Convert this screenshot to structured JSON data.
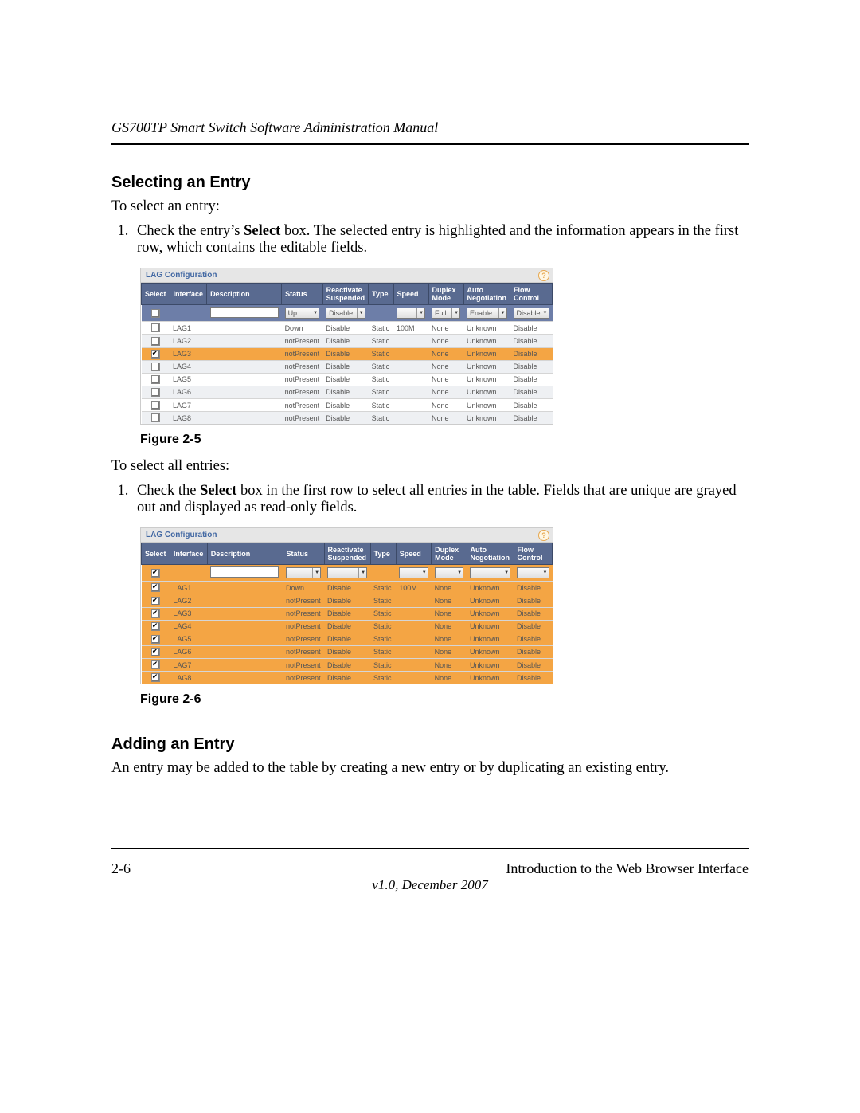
{
  "header": {
    "title": "GS700TP Smart Switch Software Administration Manual"
  },
  "section1": {
    "heading": "Selecting an Entry"
  },
  "para1": "To select an entry:",
  "step1_pre": "Check the entry’s ",
  "step1_bold": "Select",
  "step1_post": " box. The selected entry is highlighted and the information appears in the first row, which contains the editable fields.",
  "shot": {
    "title": "LAG Configuration",
    "help": "?",
    "cols": [
      "Select",
      "Interface",
      "Description",
      "Status",
      "Reactivate Suspended",
      "Type",
      "Speed",
      "Duplex Mode",
      "Auto Negotiation",
      "Flow Control"
    ],
    "editRow": {
      "status": "Up",
      "reactivate": "Disable",
      "speed": "",
      "duplex": "Full",
      "autoneg": "Enable",
      "flow": "Disable"
    }
  },
  "fig1cap": "Figure 2-5",
  "para2": "To select all entries:",
  "step2_pre": "Check the ",
  "step2_bold": "Select",
  "step2_post": " box in the first row to select all entries in the table. Fields that are unique are grayed out and displayed as read-only fields.",
  "fig2cap": "Figure 2-6",
  "section2": {
    "heading": "Adding an Entry"
  },
  "para3": "An entry may be added to the table by creating a new entry or by duplicating an existing entry.",
  "footer": {
    "page": "2-6",
    "chapter": "Introduction to the Web Browser Interface",
    "version": "v1.0, December 2007"
  },
  "rows1": [
    {
      "checked": false,
      "if": "LAG1",
      "status": "Down",
      "react": "Disable",
      "type": "Static",
      "speed": "100M",
      "dup": "None",
      "auto": "Unknown",
      "flow": "Disable",
      "cls": ""
    },
    {
      "checked": false,
      "if": "LAG2",
      "status": "notPresent",
      "react": "Disable",
      "type": "Static",
      "speed": "",
      "dup": "None",
      "auto": "Unknown",
      "flow": "Disable",
      "cls": "row-alt"
    },
    {
      "checked": true,
      "if": "LAG3",
      "status": "notPresent",
      "react": "Disable",
      "type": "Static",
      "speed": "",
      "dup": "None",
      "auto": "Unknown",
      "flow": "Disable",
      "cls": "row-selected"
    },
    {
      "checked": false,
      "if": "LAG4",
      "status": "notPresent",
      "react": "Disable",
      "type": "Static",
      "speed": "",
      "dup": "None",
      "auto": "Unknown",
      "flow": "Disable",
      "cls": "row-alt"
    },
    {
      "checked": false,
      "if": "LAG5",
      "status": "notPresent",
      "react": "Disable",
      "type": "Static",
      "speed": "",
      "dup": "None",
      "auto": "Unknown",
      "flow": "Disable",
      "cls": ""
    },
    {
      "checked": false,
      "if": "LAG6",
      "status": "notPresent",
      "react": "Disable",
      "type": "Static",
      "speed": "",
      "dup": "None",
      "auto": "Unknown",
      "flow": "Disable",
      "cls": "row-alt"
    },
    {
      "checked": false,
      "if": "LAG7",
      "status": "notPresent",
      "react": "Disable",
      "type": "Static",
      "speed": "",
      "dup": "None",
      "auto": "Unknown",
      "flow": "Disable",
      "cls": ""
    },
    {
      "checked": false,
      "if": "LAG8",
      "status": "notPresent",
      "react": "Disable",
      "type": "Static",
      "speed": "",
      "dup": "None",
      "auto": "Unknown",
      "flow": "Disable",
      "cls": "row-alt"
    }
  ],
  "rows2": [
    {
      "checked": true,
      "if": "LAG1",
      "status": "Down",
      "react": "Disable",
      "type": "Static",
      "speed": "100M",
      "dup": "None",
      "auto": "Unknown",
      "flow": "Disable"
    },
    {
      "checked": true,
      "if": "LAG2",
      "status": "notPresent",
      "react": "Disable",
      "type": "Static",
      "speed": "",
      "dup": "None",
      "auto": "Unknown",
      "flow": "Disable"
    },
    {
      "checked": true,
      "if": "LAG3",
      "status": "notPresent",
      "react": "Disable",
      "type": "Static",
      "speed": "",
      "dup": "None",
      "auto": "Unknown",
      "flow": "Disable"
    },
    {
      "checked": true,
      "if": "LAG4",
      "status": "notPresent",
      "react": "Disable",
      "type": "Static",
      "speed": "",
      "dup": "None",
      "auto": "Unknown",
      "flow": "Disable"
    },
    {
      "checked": true,
      "if": "LAG5",
      "status": "notPresent",
      "react": "Disable",
      "type": "Static",
      "speed": "",
      "dup": "None",
      "auto": "Unknown",
      "flow": "Disable"
    },
    {
      "checked": true,
      "if": "LAG6",
      "status": "notPresent",
      "react": "Disable",
      "type": "Static",
      "speed": "",
      "dup": "None",
      "auto": "Unknown",
      "flow": "Disable"
    },
    {
      "checked": true,
      "if": "LAG7",
      "status": "notPresent",
      "react": "Disable",
      "type": "Static",
      "speed": "",
      "dup": "None",
      "auto": "Unknown",
      "flow": "Disable"
    },
    {
      "checked": true,
      "if": "LAG8",
      "status": "notPresent",
      "react": "Disable",
      "type": "Static",
      "speed": "",
      "dup": "None",
      "auto": "Unknown",
      "flow": "Disable"
    }
  ],
  "colw": {
    "sel": 32,
    "if": 46,
    "desc": 90,
    "stat": 48,
    "react": 56,
    "type": 32,
    "speed": 44,
    "dup": 42,
    "auto": 56,
    "flow": 48
  }
}
